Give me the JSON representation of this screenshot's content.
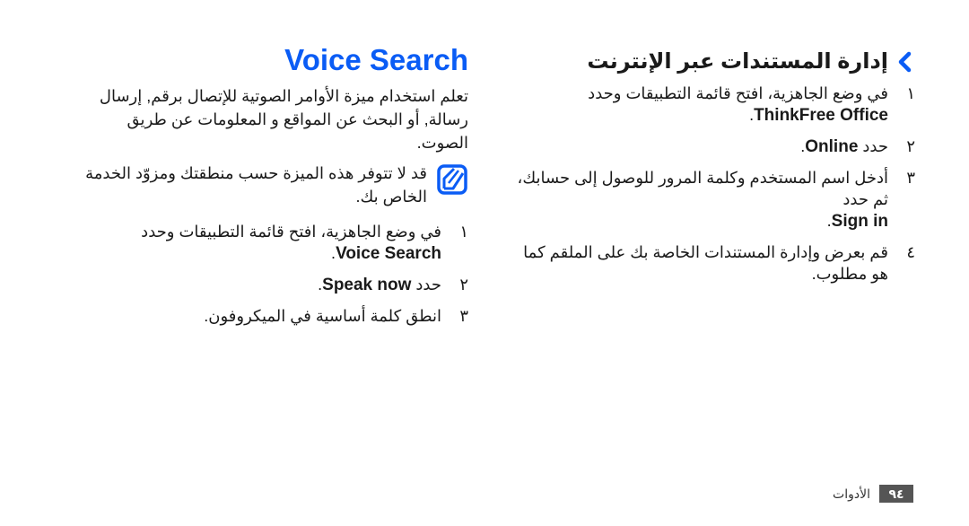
{
  "colors": {
    "accent": "#0a5cf5",
    "page_badge_bg": "#555555",
    "text": "#1a1a1a"
  },
  "right_section": {
    "icon": "chevron-left-icon",
    "title": "إدارة المستندات عبر الإنترنت",
    "steps": [
      {
        "num": "١",
        "text": "في وضع الجاهزية، افتح قائمة التطبيقات وحدد",
        "en": "ThinkFree Office",
        "suffix": "."
      },
      {
        "num": "٢",
        "text": "حدد",
        "en": "Online",
        "suffix": "."
      },
      {
        "num": "٣",
        "text": "أدخل اسم المستخدم وكلمة المرور للوصول إلى حسابك، ثم حدد",
        "en": "Sign in",
        "suffix": "."
      },
      {
        "num": "٤",
        "text": "قم بعرض وإدارة المستندات الخاصة بك على الملقم كما هو مطلوب.",
        "en": "",
        "suffix": ""
      }
    ]
  },
  "left_section": {
    "title": "Voice Search",
    "intro": "تعلم استخدام ميزة الأوامر الصوتية للإتصال برقم, إرسال رسالة, أو البحث عن المواقع و المعلومات عن طريق الصوت.",
    "note": {
      "icon": "note-pencil-icon",
      "text": "قد لا تتوفر هذه الميزة حسب منطقتك ومزوّد الخدمة الخاص بك."
    },
    "steps": [
      {
        "num": "١",
        "text": "في وضع الجاهزية، افتح قائمة التطبيقات وحدد",
        "en": "Voice Search",
        "suffix": "."
      },
      {
        "num": "٢",
        "text": "حدد",
        "en": "Speak now",
        "suffix": "."
      },
      {
        "num": "٣",
        "text": "انطق كلمة أساسية في الميكروفون.",
        "en": "",
        "suffix": ""
      }
    ]
  },
  "footer": {
    "page_number": "٩٤",
    "chapter": "الأدوات"
  }
}
